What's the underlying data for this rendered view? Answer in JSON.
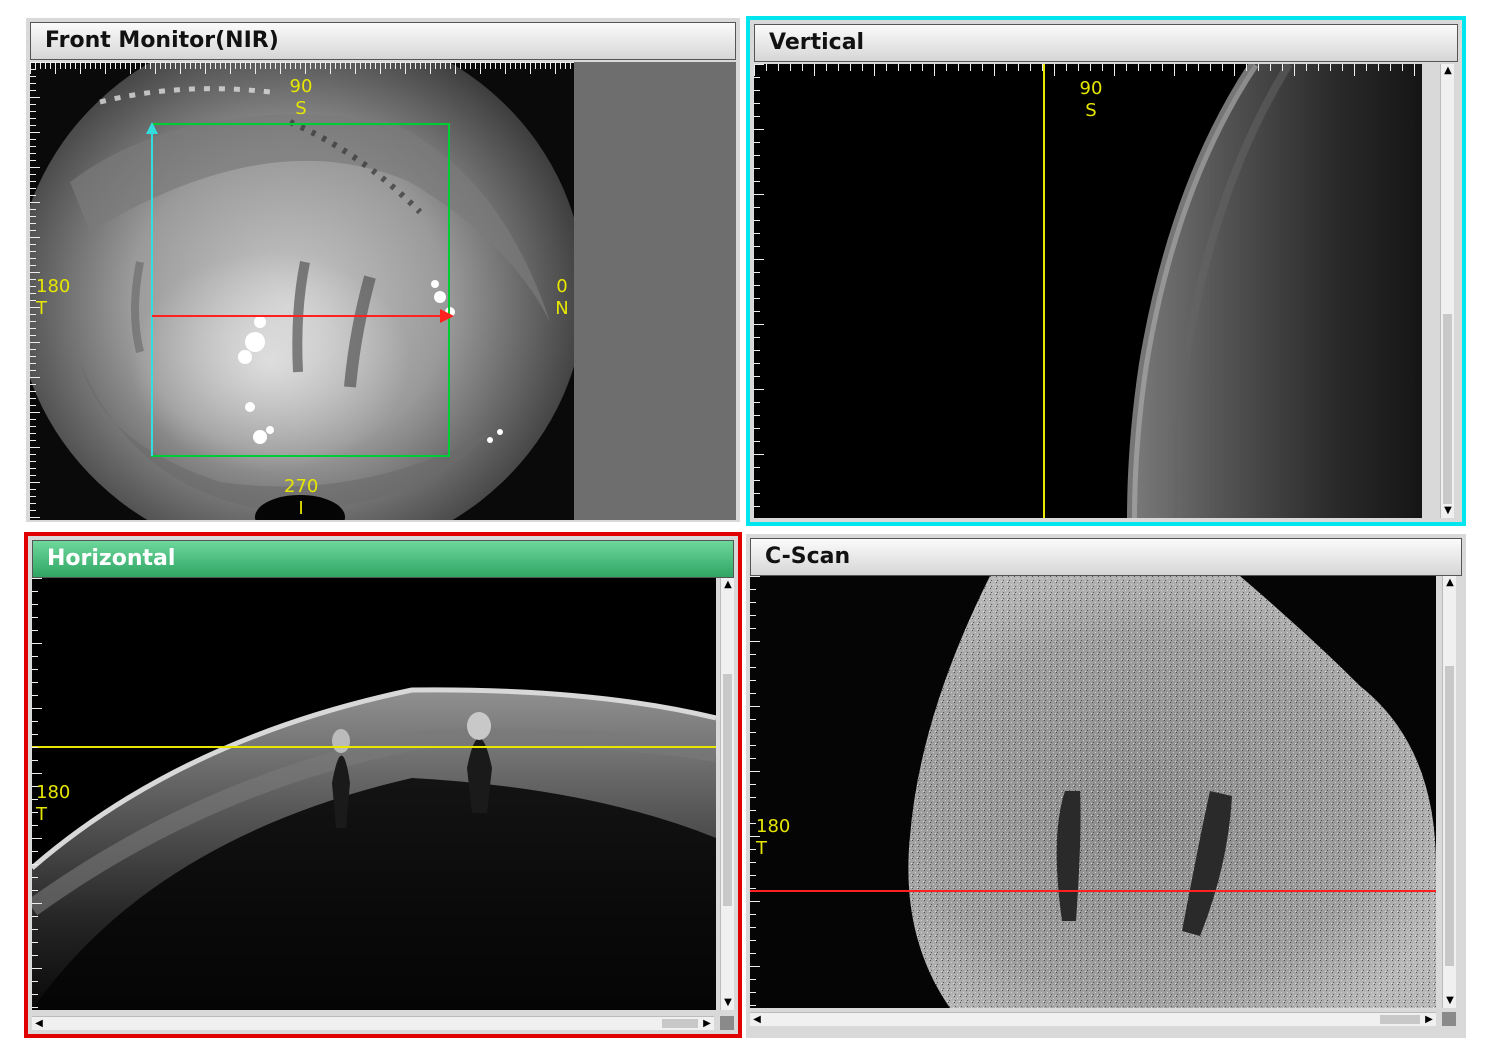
{
  "panels": {
    "front": {
      "title": "Front Monitor(NIR)",
      "labels": {
        "top_deg": "90",
        "top_dir": "S",
        "left_deg": "180",
        "left_dir": "T",
        "right_deg": "0",
        "right_dir": "N",
        "bottom_deg": "270",
        "bottom_dir": "I"
      }
    },
    "vertical": {
      "title": "Vertical",
      "labels": {
        "top_deg": "90",
        "top_dir": "S"
      }
    },
    "horizontal": {
      "title": "Horizontal",
      "labels": {
        "left_deg": "180",
        "left_dir": "T"
      }
    },
    "cscan": {
      "title": "C-Scan",
      "labels": {
        "left_deg": "180",
        "left_dir": "T"
      }
    }
  },
  "colors": {
    "active_vertical_border": "#00e5ee",
    "active_horizontal_border": "#e00000",
    "scan_box": "#00cc33",
    "vertical_scan_line": "#33dddd",
    "horizontal_scan_line": "#ff2020",
    "marker_line": "#e6e600",
    "label_text": "#e6e600"
  },
  "icons": {
    "scroll_up": "▲",
    "scroll_down": "▼",
    "scroll_left": "◀",
    "scroll_right": "▶"
  }
}
